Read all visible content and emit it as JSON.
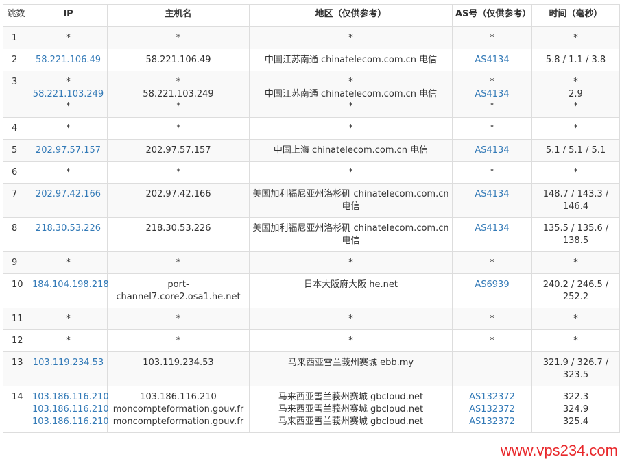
{
  "headers": {
    "hop": "跳数",
    "ip": "IP",
    "hostname": "主机名",
    "region": "地区（仅供参考）",
    "asn": "AS号（仅供参考）",
    "time": "时间（毫秒）"
  },
  "rows": [
    {
      "hop": "1",
      "ip": [
        "*"
      ],
      "hostname": [
        "*"
      ],
      "region": [
        "*"
      ],
      "asn": [
        "*"
      ],
      "time": [
        "*"
      ]
    },
    {
      "hop": "2",
      "ip": [
        "58.221.106.49"
      ],
      "hostname": [
        "58.221.106.49"
      ],
      "region": [
        "中国江苏南通 chinatelecom.com.cn 电信"
      ],
      "asn": [
        "AS4134"
      ],
      "time": [
        "5.8 / 1.1 / 3.8"
      ]
    },
    {
      "hop": "3",
      "ip": [
        "*",
        "58.221.103.249",
        "*"
      ],
      "hostname": [
        "*",
        "58.221.103.249",
        "*"
      ],
      "region": [
        "*",
        "中国江苏南通 chinatelecom.com.cn 电信",
        "*"
      ],
      "asn": [
        "*",
        "AS4134",
        "*"
      ],
      "time": [
        "*",
        "2.9",
        "*"
      ]
    },
    {
      "hop": "4",
      "ip": [
        "*"
      ],
      "hostname": [
        "*"
      ],
      "region": [
        "*"
      ],
      "asn": [
        "*"
      ],
      "time": [
        "*"
      ]
    },
    {
      "hop": "5",
      "ip": [
        "202.97.57.157"
      ],
      "hostname": [
        "202.97.57.157"
      ],
      "region": [
        "中国上海 chinatelecom.com.cn 电信"
      ],
      "asn": [
        "AS4134"
      ],
      "time": [
        "5.1 / 5.1 / 5.1"
      ]
    },
    {
      "hop": "6",
      "ip": [
        "*"
      ],
      "hostname": [
        "*"
      ],
      "region": [
        "*"
      ],
      "asn": [
        "*"
      ],
      "time": [
        "*"
      ]
    },
    {
      "hop": "7",
      "ip": [
        "202.97.42.166"
      ],
      "hostname": [
        "202.97.42.166"
      ],
      "region": [
        "美国加利福尼亚州洛杉矶 chinatelecom.com.cn 电信"
      ],
      "asn": [
        "AS4134"
      ],
      "time": [
        "148.7 / 143.3 / 146.4"
      ]
    },
    {
      "hop": "8",
      "ip": [
        "218.30.53.226"
      ],
      "hostname": [
        "218.30.53.226"
      ],
      "region": [
        "美国加利福尼亚州洛杉矶 chinatelecom.com.cn 电信"
      ],
      "asn": [
        "AS4134"
      ],
      "time": [
        "135.5 / 135.6 / 138.5"
      ]
    },
    {
      "hop": "9",
      "ip": [
        "*"
      ],
      "hostname": [
        "*"
      ],
      "region": [
        "*"
      ],
      "asn": [
        "*"
      ],
      "time": [
        "*"
      ]
    },
    {
      "hop": "10",
      "ip": [
        "184.104.198.218"
      ],
      "hostname": [
        "port-channel7.core2.osa1.he.net"
      ],
      "region": [
        "日本大阪府大阪 he.net"
      ],
      "asn": [
        "AS6939"
      ],
      "time": [
        "240.2 / 246.5 / 252.2"
      ]
    },
    {
      "hop": "11",
      "ip": [
        "*"
      ],
      "hostname": [
        "*"
      ],
      "region": [
        "*"
      ],
      "asn": [
        "*"
      ],
      "time": [
        "*"
      ]
    },
    {
      "hop": "12",
      "ip": [
        "*"
      ],
      "hostname": [
        "*"
      ],
      "region": [
        "*"
      ],
      "asn": [
        "*"
      ],
      "time": [
        "*"
      ]
    },
    {
      "hop": "13",
      "ip": [
        "103.119.234.53"
      ],
      "hostname": [
        "103.119.234.53"
      ],
      "region": [
        "马来西亚雪兰莪州赛城 ebb.my"
      ],
      "asn": [
        ""
      ],
      "time": [
        "321.9 / 326.7 / 323.5"
      ]
    },
    {
      "hop": "14",
      "ip": [
        "103.186.116.210",
        "103.186.116.210",
        "103.186.116.210"
      ],
      "hostname": [
        "103.186.116.210",
        "moncompteformation.gouv.fr",
        "moncompteformation.gouv.fr"
      ],
      "region": [
        "马来西亚雪兰莪州赛城 gbcloud.net",
        "马来西亚雪兰莪州赛城 gbcloud.net",
        "马来西亚雪兰莪州赛城 gbcloud.net"
      ],
      "asn": [
        "AS132372",
        "AS132372",
        "AS132372"
      ],
      "time": [
        "322.3",
        "324.9",
        "325.4"
      ]
    }
  ],
  "watermark": "www.vps234.com",
  "colors": {
    "link": "#337ab7",
    "watermark": "#e8282b",
    "border": "#dddddd",
    "stripe": "#f9f9f9"
  }
}
